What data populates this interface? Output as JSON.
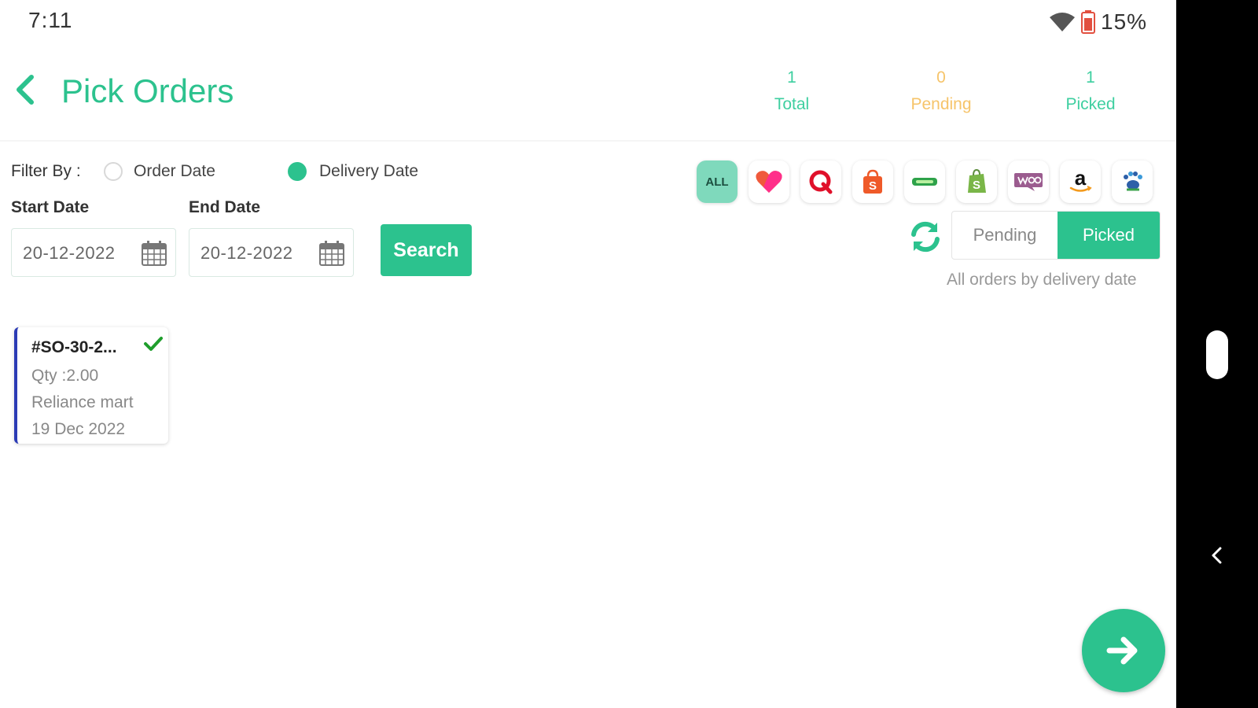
{
  "status_bar": {
    "time": "7:11",
    "battery_text": "15%",
    "icons": [
      "wifi-icon",
      "battery-low-icon"
    ]
  },
  "header": {
    "back_icon": "chevron-left-icon",
    "title": "Pick Orders",
    "stats": {
      "total": {
        "value": "1",
        "label": "Total"
      },
      "pending": {
        "value": "0",
        "label": "Pending"
      },
      "picked": {
        "value": "1",
        "label": "Picked"
      }
    }
  },
  "filter": {
    "label": "Filter By :",
    "options": [
      {
        "label": "Order Date",
        "selected": false
      },
      {
        "label": "Delivery Date",
        "selected": true
      }
    ]
  },
  "dates": {
    "start_label": "Start Date",
    "start_value": "20-12-2022",
    "end_label": "End Date",
    "end_value": "20-12-2022",
    "calendar_icon": "calendar-icon"
  },
  "search_button": "Search",
  "channels": [
    {
      "name": "all",
      "label": "ALL",
      "selected": true
    },
    {
      "name": "heart-logo-icon"
    },
    {
      "name": "q-logo-icon"
    },
    {
      "name": "shopping-bag-logo-icon"
    },
    {
      "name": "green-badge-logo-icon"
    },
    {
      "name": "shopify-logo-icon"
    },
    {
      "name": "woo-logo-icon"
    },
    {
      "name": "amazon-logo-icon"
    },
    {
      "name": "paw-logo-icon"
    }
  ],
  "toggle": {
    "refresh_icon": "refresh-icon",
    "pending_label": "Pending",
    "picked_label": "Picked",
    "selected": "Picked",
    "caption": "All orders by  delivery date"
  },
  "orders": [
    {
      "id": "#SO-30-2...",
      "qty": "Qty :2.00",
      "store": "Reliance mart",
      "date": "19 Dec 2022",
      "status_icon": "check-icon"
    }
  ],
  "fab_icon": "arrow-right-icon",
  "colors": {
    "accent": "#2cc28e",
    "pending": "#f6c46a",
    "card_border": "#2b3bb5",
    "nav_panel": "#000000"
  }
}
